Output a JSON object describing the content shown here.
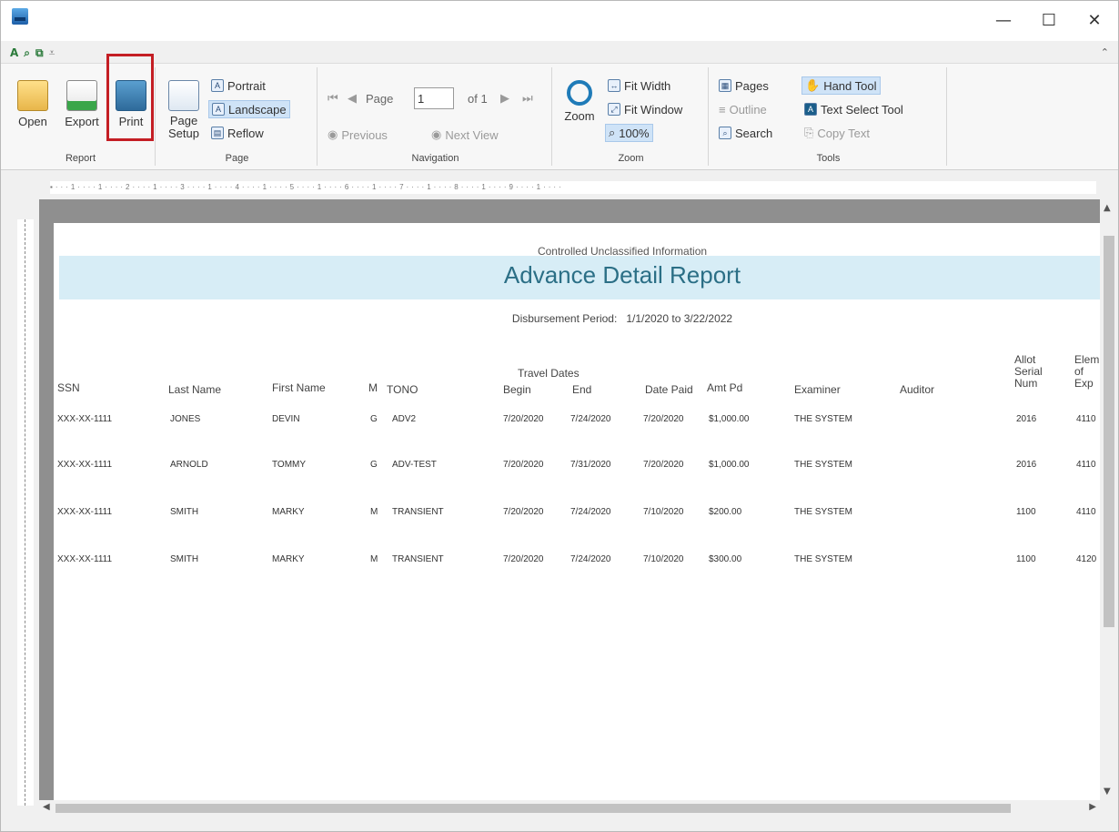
{
  "window": {
    "minimize": "—",
    "maximize": "☐",
    "close": "✕"
  },
  "ribbon": {
    "report": {
      "label": "Report",
      "open": "Open",
      "export": "Export",
      "print": "Print"
    },
    "page": {
      "label": "Page",
      "setup_line1": "Page",
      "setup_line2": "Setup",
      "portrait": "Portrait",
      "landscape": "Landscape",
      "reflow": "Reflow"
    },
    "navigation": {
      "label": "Navigation",
      "page_text": "Page",
      "page_value": "1",
      "of_text": "of 1",
      "previous": "Previous",
      "next_view": "Next View"
    },
    "zoom": {
      "label": "Zoom",
      "zoom": "Zoom",
      "fit_width": "Fit Width",
      "fit_window": "Fit Window",
      "pct": "100%"
    },
    "view": {
      "pages": "Pages",
      "outline": "Outline",
      "search": "Search"
    },
    "tools": {
      "label": "Tools",
      "hand": "Hand Tool",
      "text_select": "Text Select Tool",
      "copy_text": "Copy Text"
    }
  },
  "report": {
    "classification": "Controlled Unclassified Information",
    "title": "Advance Detail Report",
    "period_label": "Disbursement Period:",
    "period_value": "1/1/2020 to 3/22/2022",
    "headers": {
      "ssn": "SSN",
      "last": "Last Name",
      "first": "First Name",
      "m": "M",
      "tono": "TONO",
      "travel_dates": "Travel Dates",
      "begin": "Begin",
      "end": "End",
      "date_paid": "Date Paid",
      "amt": "Amt Pd",
      "examiner": "Examiner",
      "auditor": "Auditor",
      "allot1": "Allot",
      "allot2": "Serial",
      "allot3": "Num",
      "elem1": "Elem",
      "elem2": "of",
      "elem3": "Exp"
    },
    "rows": [
      {
        "ssn": "XXX-XX-1111",
        "last": "JONES",
        "first": "DEVIN",
        "m": "G",
        "tono": "ADV2",
        "begin": "7/20/2020",
        "end": "7/24/2020",
        "paid": "7/20/2020",
        "amt": "$1,000.00",
        "examiner": "THE SYSTEM",
        "auditor": "",
        "allot": "2016",
        "elem": "4110"
      },
      {
        "ssn": "XXX-XX-1111",
        "last": "ARNOLD",
        "first": "TOMMY",
        "m": "G",
        "tono": "ADV-TEST",
        "begin": "7/20/2020",
        "end": "7/31/2020",
        "paid": "7/20/2020",
        "amt": "$1,000.00",
        "examiner": "THE SYSTEM",
        "auditor": "",
        "allot": "2016",
        "elem": "4110"
      },
      {
        "ssn": "XXX-XX-1111",
        "last": "SMITH",
        "first": "MARKY",
        "m": "M",
        "tono": "TRANSIENT",
        "begin": "7/20/2020",
        "end": "7/24/2020",
        "paid": "7/10/2020",
        "amt": "$200.00",
        "examiner": "THE SYSTEM",
        "auditor": "",
        "allot": "1100",
        "elem": "4110"
      },
      {
        "ssn": "XXX-XX-1111",
        "last": "SMITH",
        "first": "MARKY",
        "m": "M",
        "tono": "TRANSIENT",
        "begin": "7/20/2020",
        "end": "7/24/2020",
        "paid": "7/10/2020",
        "amt": "$300.00",
        "examiner": "THE SYSTEM",
        "auditor": "",
        "allot": "1100",
        "elem": "4120"
      }
    ]
  }
}
